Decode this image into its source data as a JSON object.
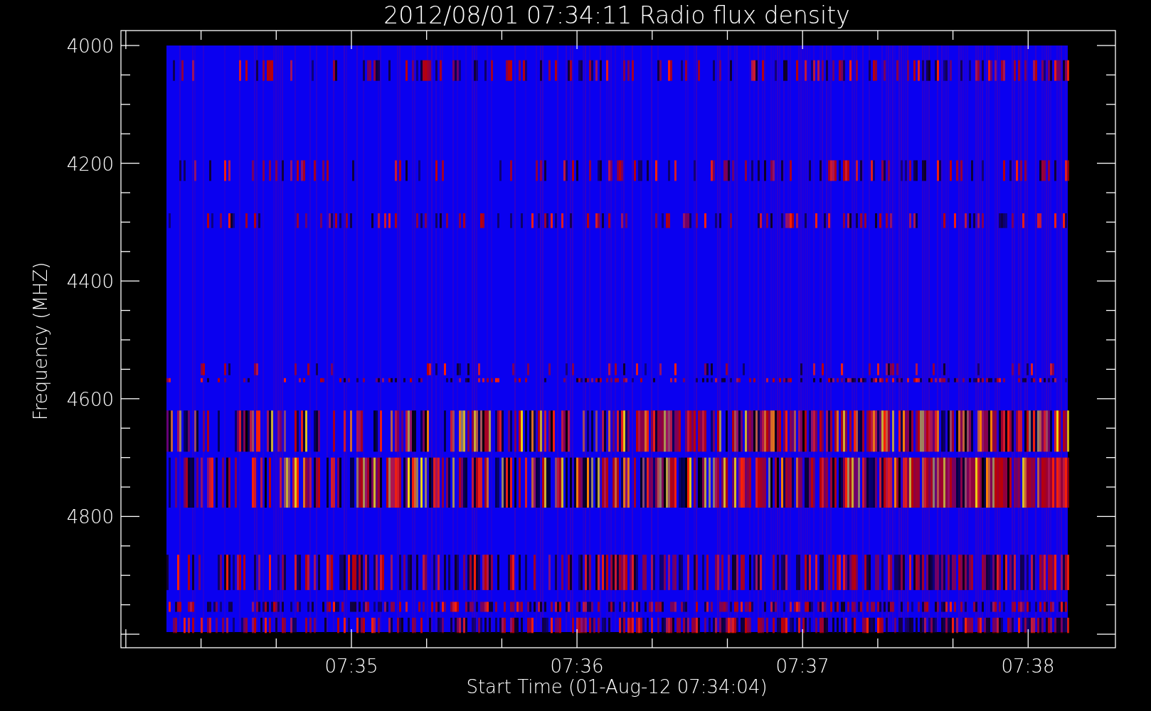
{
  "title": "2012/08/01 07:34:11 Radio flux density",
  "plot": {
    "ylabel": "Frequency (MHZ)",
    "xlabel": "Start Time (01-Aug-12 07:34:04)",
    "yticks": [
      "4000",
      "4200",
      "4400",
      "4600",
      "4800"
    ],
    "xticks": [
      "07:35",
      "07:36",
      "07:37",
      "07:38"
    ]
  }
}
